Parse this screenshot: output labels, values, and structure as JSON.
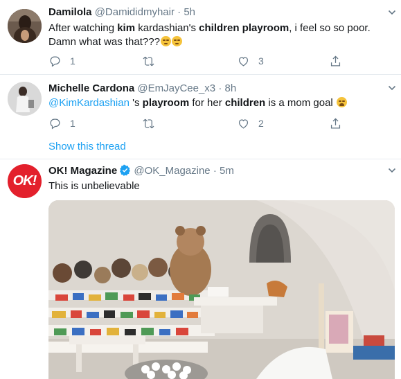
{
  "tweets": [
    {
      "name": "Damilola",
      "handle": "@Damididmyhair",
      "time": "5h",
      "text_parts": [
        "After watching ",
        "kim",
        " kardashian's ",
        "children playroom",
        ", i feel so so poor. Damn what was that???"
      ],
      "emojis": [
        "persevering-face",
        "persevering-face"
      ],
      "replies": "1",
      "retweets": "",
      "likes": "3"
    },
    {
      "name": "Michelle Cardona",
      "handle": "@EmJayCee_x3",
      "time": "8h",
      "mention": "@KimKardashian",
      "text_parts": [
        " 's ",
        "playroom",
        " for her ",
        "children",
        " is a mom goal "
      ],
      "emojis": [
        "weary-face"
      ],
      "replies": "1",
      "retweets": "",
      "likes": "2"
    }
  ],
  "show_thread": "Show this thread",
  "ok_tweet": {
    "name": "OK! Magazine",
    "handle": "@OK_Magazine",
    "time": "5m",
    "text": "This is unbelievable",
    "avatar_text": "OK!",
    "media_alt": "photo of a children's playroom with shelves of stuffed animals and toy cars"
  },
  "separator": "·",
  "colors": {
    "link": "#1da1f2",
    "secondary_text": "#657786",
    "ok_red": "#e3202c",
    "verified": "#1da1f2",
    "divider": "#e6ecf0"
  }
}
